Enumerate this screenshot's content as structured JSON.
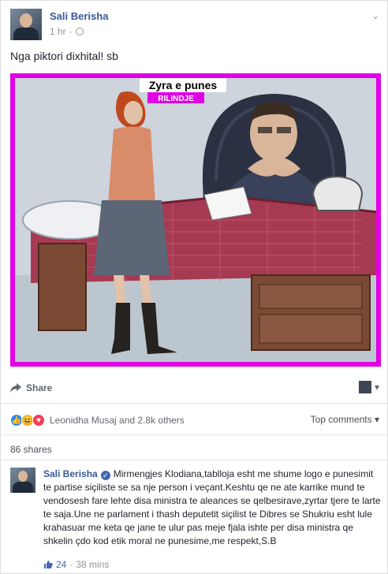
{
  "post": {
    "author": "Sali Berisha",
    "time": "1 hr",
    "separator": "·",
    "text": "Nga piktori dixhital! sb",
    "options_icon": "chevron-down-icon",
    "audience_icon": "globe-icon"
  },
  "image": {
    "caption_title": "Zyra e punes",
    "caption_sub": "RILINDJE",
    "frame_color": "#e000e6"
  },
  "actions": {
    "share_label": "Share",
    "share_icon": "share-arrow-icon"
  },
  "reactions": {
    "icons": [
      "like-icon",
      "haha-icon",
      "love-icon"
    ],
    "summary": "Leonidha Musaj and 2.8k others",
    "sort_label": "Top comments",
    "sort_caret": "▾"
  },
  "shares_text": "86 shares",
  "comment": {
    "author": "Sali Berisha",
    "verified_icon": "verified-badge-icon",
    "text": "Mirmengjes Klodiana,tablloja esht me shume logo e punesimit te partise siçiliste se sa nje person i veçant.Keshtu qe ne ate karrike mund te vendosesh fare lehte disa ministra te aleances se qelbesirave,zyrtar tjere te larte te saja.Une ne parlament i thash deputetit siçilist te Dibres se Shukriu esht lule krahasuar me keta qe jane te ulur pas meje fjala ishte per disa ministra qe shkelin çdo kod etik moral ne punesime,me respekt,S.B",
    "likes": "24",
    "time": "38 mins",
    "separator": "·"
  },
  "colors": {
    "link": "#365899",
    "accent": "#4267b2",
    "muted": "#90949c"
  }
}
